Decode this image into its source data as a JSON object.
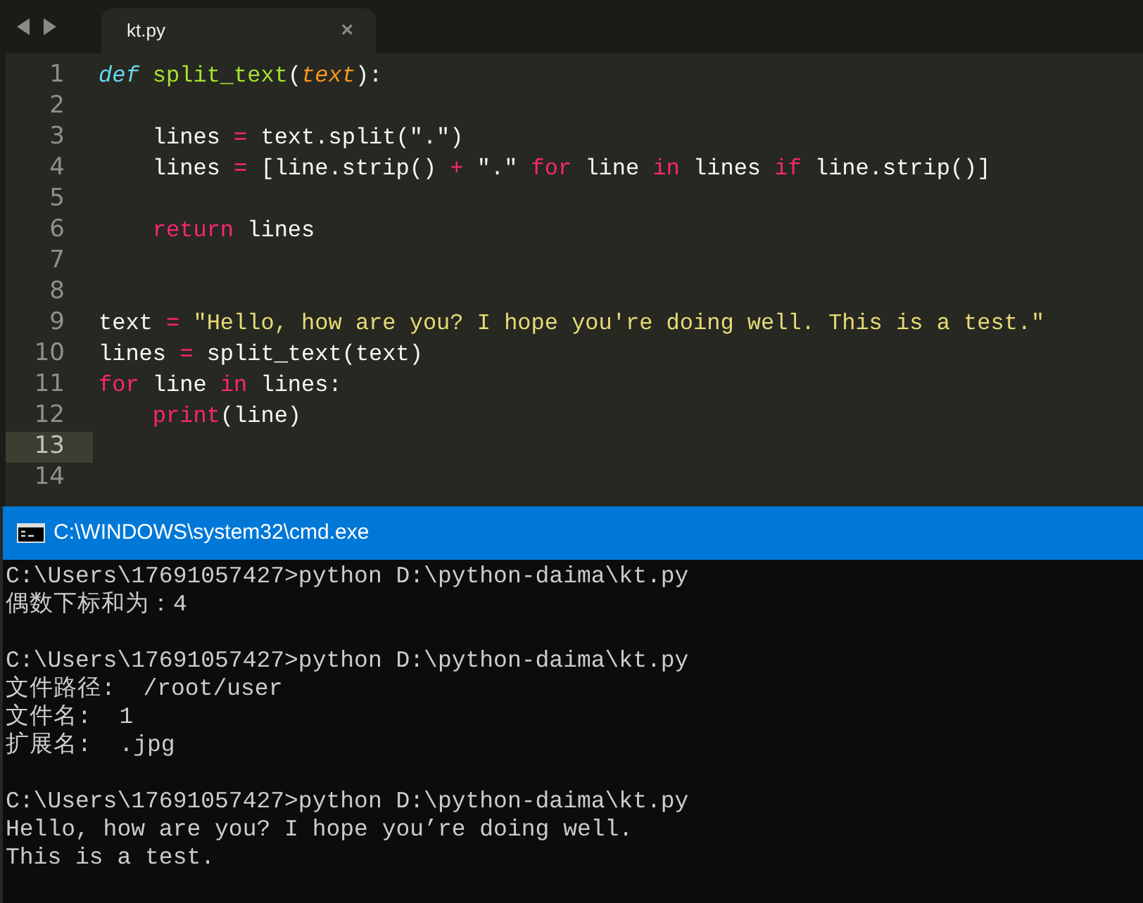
{
  "editor": {
    "tabs": [
      {
        "label": "kt.py",
        "close": "×",
        "selected": true
      }
    ],
    "lines": [
      {
        "number": "1",
        "current": false,
        "tokens": [
          {
            "kind": "storage",
            "text": "def"
          },
          {
            "kind": "function",
            "text": " split_text"
          },
          {
            "kind": "plain",
            "text": "("
          },
          {
            "kind": "param",
            "text": "text"
          },
          {
            "kind": "plain",
            "text": "):"
          }
        ]
      },
      {
        "number": "2",
        "current": false
      },
      {
        "number": "3",
        "current": false,
        "tokens": [
          {
            "kind": "plain",
            "text": "    lines "
          },
          {
            "kind": "keyword",
            "text": "="
          },
          {
            "kind": "plain",
            "text": " text.split(\".\")"
          }
        ]
      },
      {
        "number": "4",
        "current": false,
        "tokens": [
          {
            "kind": "plain",
            "text": "    lines "
          },
          {
            "kind": "keyword",
            "text": "="
          },
          {
            "kind": "plain",
            "text": " [line.strip() "
          },
          {
            "kind": "keyword",
            "text": "+"
          },
          {
            "kind": "plain",
            "text": " \".\" "
          },
          {
            "kind": "keyword",
            "text": "for"
          },
          {
            "kind": "plain",
            "text": " line "
          },
          {
            "kind": "keyword",
            "text": "in"
          },
          {
            "kind": "plain",
            "text": " lines "
          },
          {
            "kind": "keyword",
            "text": "if"
          },
          {
            "kind": "plain",
            "text": " line.strip()]"
          }
        ]
      },
      {
        "number": "5",
        "current": false
      },
      {
        "number": "6",
        "current": false,
        "tokens": [
          {
            "kind": "keyword",
            "text": "    return"
          },
          {
            "kind": "plain",
            "text": " lines"
          }
        ]
      },
      {
        "number": "7",
        "current": false
      },
      {
        "number": "8",
        "current": false
      },
      {
        "number": "9",
        "current": false,
        "tokens": [
          {
            "kind": "plain",
            "text": "text "
          },
          {
            "kind": "keyword",
            "text": "="
          },
          {
            "kind": "string",
            "text": " \"Hello, how are you? I hope you're doing well. This is a test.\""
          }
        ]
      },
      {
        "number": "10",
        "current": false,
        "tokens": [
          {
            "kind": "plain",
            "text": "lines "
          },
          {
            "kind": "keyword",
            "text": "="
          },
          {
            "kind": "plain",
            "text": " split_text(text)"
          }
        ]
      },
      {
        "number": "11",
        "current": false,
        "tokens": [
          {
            "kind": "keyword",
            "text": "for"
          },
          {
            "kind": "plain",
            "text": " line "
          },
          {
            "kind": "keyword",
            "text": "in"
          },
          {
            "kind": "plain",
            "text": " lines:"
          }
        ]
      },
      {
        "number": "12",
        "current": false,
        "tokens": [
          {
            "kind": "keyword",
            "text": "    print"
          },
          {
            "kind": "plain",
            "text": "(line)"
          }
        ]
      },
      {
        "number": "13",
        "current": true
      },
      {
        "number": "14",
        "current": false
      }
    ]
  },
  "console": {
    "title": "C:\\WINDOWS\\system32\\cmd.exe",
    "blocks": [
      {
        "command": "C:\\Users\\17691057427>python D:\\python-daima\\kt.py",
        "output": [
          "偶数下标和为：4"
        ]
      },
      {
        "command": "C:\\Users\\17691057427>python D:\\python-daima\\kt.py",
        "output": [
          "文件路径:  /root/user",
          "文件名:  1",
          "扩展名:  .jpg"
        ]
      },
      {
        "command": "C:\\Users\\17691057427>python D:\\python-daima\\kt.py",
        "output": [
          "Hello, how are you? I hope you’re doing well.",
          "This is a test."
        ]
      }
    ]
  }
}
